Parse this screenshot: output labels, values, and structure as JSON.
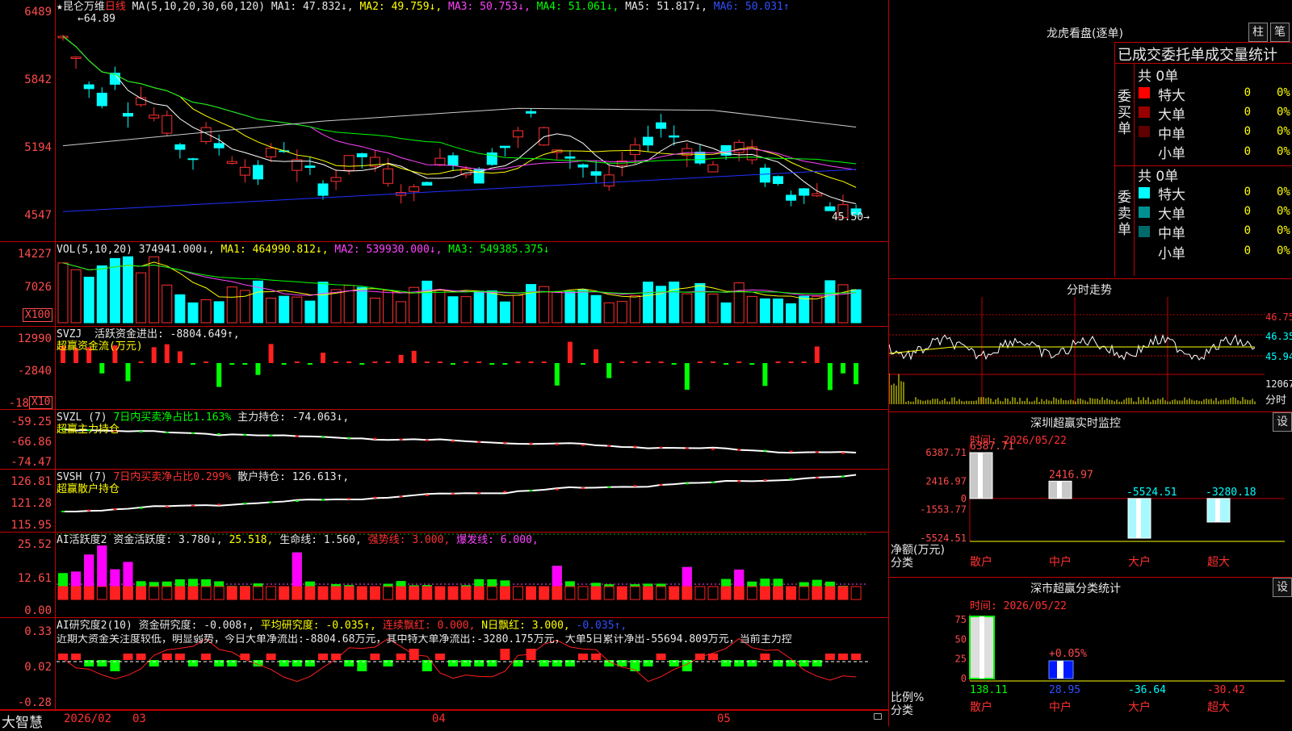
{
  "stock": {
    "name": "★昆仑万维",
    "period": "日线",
    "ma_label": "MA(5,10,20,30,60,120)",
    "ma1": "MA1: 47.832↓,",
    "ma2": "MA2: 49.759↓,",
    "ma3": "MA3: 50.753↓,",
    "ma4": "MA4: 51.061↓,",
    "ma5": "MA5: 51.817↓,",
    "ma6": "MA6: 50.031↑",
    "high_mark": "64.89",
    "low_mark": "45.50",
    "price_ticks": [
      "6489",
      "5842",
      "5194",
      "4547"
    ],
    "colors": {
      "up": "#ff3030",
      "down": "#00ffff",
      "grid": "#c00000"
    }
  },
  "vol": {
    "label": "VOL(5,10,20)",
    "value": "374941.000↓,",
    "ma1": "MA1: 464990.812↓,",
    "ma2": "MA2: 539930.000↓,",
    "ma3": "MA3: 549385.375↓",
    "ticks": [
      "14227",
      "7026"
    ],
    "unit": "X100"
  },
  "svzj": {
    "label": "SVZJ",
    "active": "活跃资金进出: -8804.649↑,",
    "title": "超赢资金流(万元)",
    "ticks": [
      "12990",
      "-2840",
      "-18"
    ],
    "unit": "X10"
  },
  "svzl": {
    "label": "SVZL (7)",
    "net": "7日内买卖净占比1.163%",
    "hold": "主力持仓: -74.063↓,",
    "title": "超赢主力持仓",
    "ticks": [
      "-59.25",
      "-66.86",
      "-74.47"
    ]
  },
  "svsh": {
    "label": "SVSH (7)",
    "net": "7日内买卖净占比0.299%",
    "hold": "散户持仓: 126.613↑,",
    "title": "超赢散户持仓",
    "ticks": [
      "126.81",
      "121.28",
      "115.95"
    ]
  },
  "ai2": {
    "label": "AI活跃度2",
    "fund": "资金活跃度: 3.780↓,",
    "val": "25.518,",
    "life": "生命线: 1.560,",
    "strong": "强势线: 3.000,",
    "burst": "爆发线: 6.000,",
    "ticks": [
      "25.52",
      "12.61",
      "0.00"
    ]
  },
  "ai_res": {
    "label": "AI研究度2(10)",
    "fund": "资金研究度: -0.008↑,",
    "avg": "平均研究度: -0.035↑,",
    "cont": "连续飘红: 0.000,",
    "nday": "N日飘红: 3.000,",
    "last": "-0.035↑,",
    "text": "近期大资金关注度较低，明显弱势，今日大单净流出:-8804.68万元，其中特大单净流出:-3280.175万元，大单5日累计净出-55694.809万元，当前主力控",
    "ticks": [
      "0.33",
      "0.02",
      "-0.28"
    ]
  },
  "xaxis": {
    "labels": [
      "2026/02",
      "03",
      "04",
      "05"
    ],
    "brand": "大智慧"
  },
  "lhb": {
    "title": "龙虎看盘(逐单)",
    "btn1": "柱",
    "btn2": "笔",
    "subtitle": "已成交委托单成交量统计",
    "buy_side": "委买单",
    "sell_side": "委卖单",
    "buy_total": "共 0单",
    "sell_total": "共 0单",
    "rows": [
      {
        "label": "特大",
        "vol": "0",
        "pct": "0%"
      },
      {
        "label": "大单",
        "vol": "0",
        "pct": "0%"
      },
      {
        "label": "中单",
        "vol": "0",
        "pct": "0%"
      },
      {
        "label": "小单",
        "vol": "0",
        "pct": "0%"
      }
    ]
  },
  "fenshi": {
    "title": "分时走势",
    "ticks": [
      "46.75",
      "46.35",
      "45.94"
    ],
    "vol_tick": "12067",
    "vol_label": "分时"
  },
  "monitor": {
    "title": "深圳超赢实时监控",
    "btn": "设",
    "time": "时间: 2026/05/22",
    "ticks": [
      "6387.71",
      "2416.97",
      "0",
      "-1553.77",
      "-5524.51"
    ],
    "ylabel": "净额(万元)",
    "xlabel": "分类",
    "cats": [
      "散户",
      "中户",
      "大户",
      "超大"
    ],
    "values": [
      6387.71,
      2416.97,
      -5524.51,
      -3280.18
    ],
    "value_labels": [
      "6387.71",
      "2416.97",
      "-5524.51",
      "-3280.18"
    ]
  },
  "classify": {
    "title": "深市超赢分类统计",
    "btn": "设",
    "time": "时间: 2026/05/22",
    "ticks": [
      "75",
      "50",
      "25",
      "0"
    ],
    "ylabel": "比例%",
    "xlabel": "分类",
    "pct_label": "+0.05%",
    "cats": [
      "散户",
      "中户",
      "大户",
      "超大"
    ],
    "values": [
      "138.11",
      "28.95",
      "-36.64",
      "-30.42"
    ]
  }
}
